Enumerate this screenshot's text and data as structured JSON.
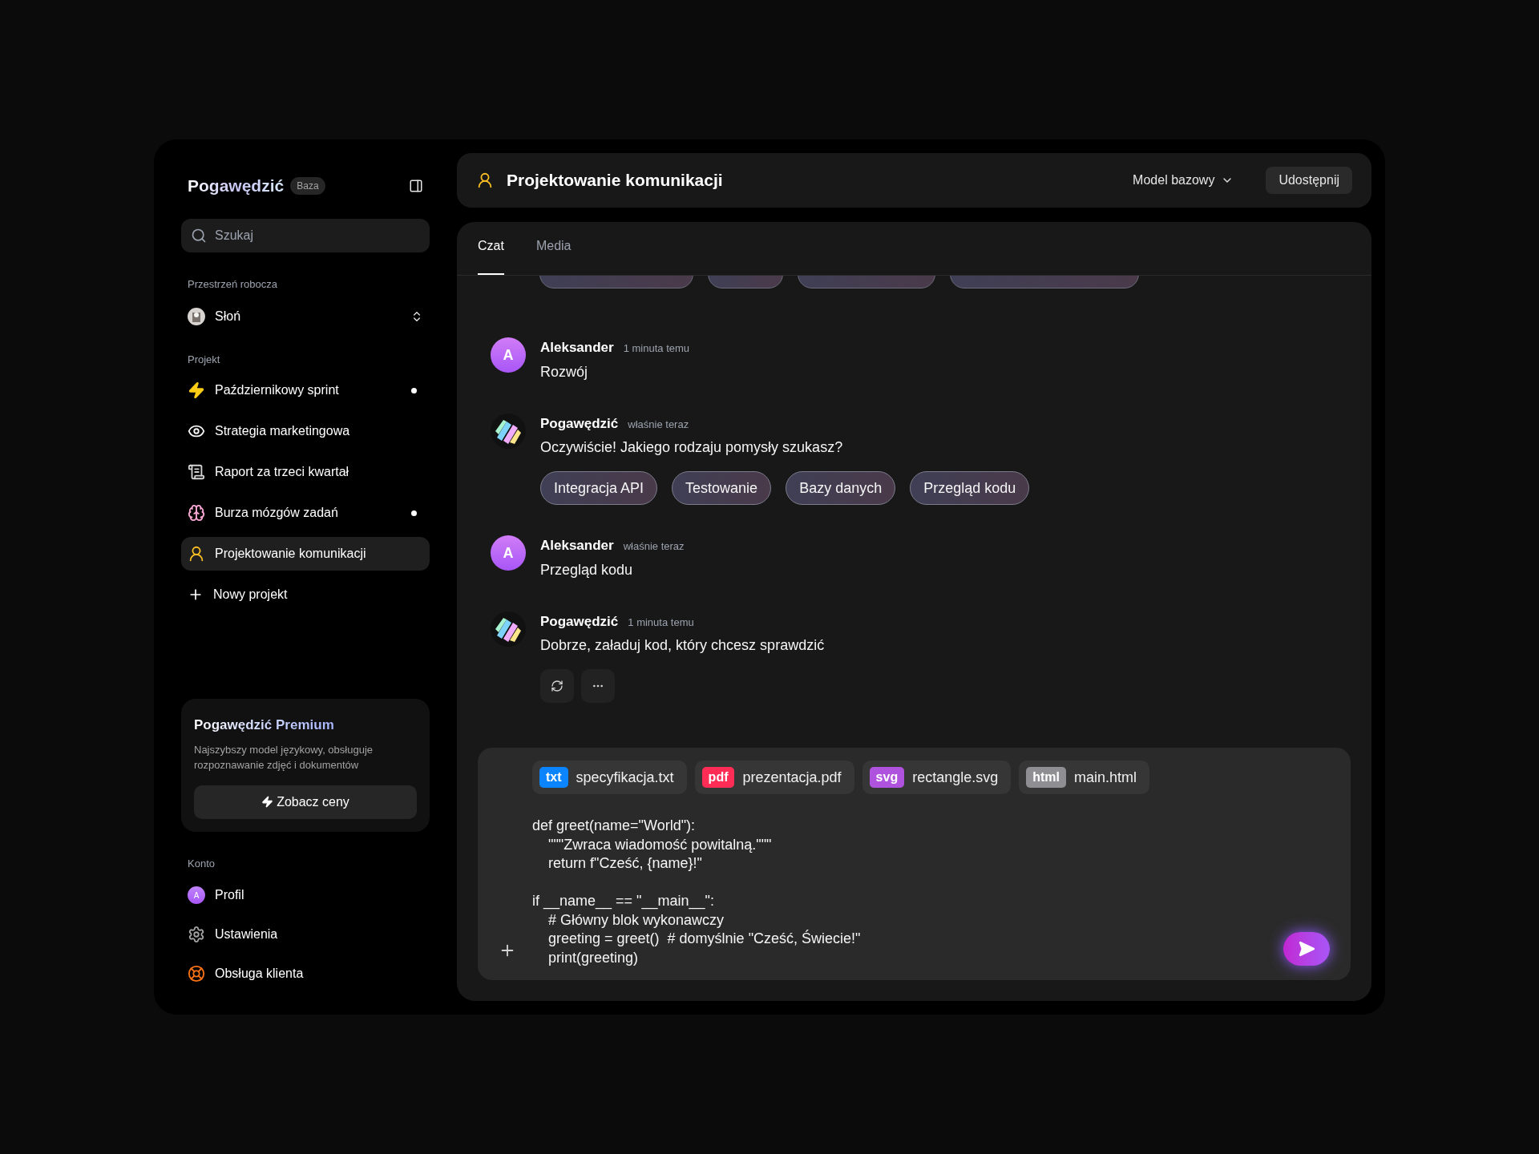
{
  "sidebar": {
    "logo": "Pogawędzić",
    "plan_badge": "Baza",
    "search": {
      "placeholder": "Szukaj"
    },
    "workspace": {
      "label": "Przestrzeń robocza",
      "name": "Słoń"
    },
    "projects_label": "Projekt",
    "projects": [
      {
        "kind": "bolt",
        "label": "Październikowy sprint",
        "unread": true,
        "selected": false
      },
      {
        "kind": "eyes",
        "label": "Strategia marketingowa",
        "unread": false,
        "selected": false
      },
      {
        "kind": "scroll",
        "label": "Raport za trzeci kwartał",
        "unread": false,
        "selected": false
      },
      {
        "kind": "brain",
        "label": "Burza mózgów zadań",
        "unread": true,
        "selected": false
      },
      {
        "kind": "person",
        "label": "Projektowanie komunikacji",
        "unread": false,
        "selected": true
      }
    ],
    "new_project": "Nowy projekt",
    "premium": {
      "title": "Pogawędzić Premium",
      "description": "Najszybszy model językowy, obsługuje rozpoznawanie zdjęć i dokumentów",
      "button": "Zobacz ceny"
    },
    "account_label": "Konto",
    "account": [
      {
        "kind": "avatar",
        "avatar_letter": "A",
        "label": "Profil"
      },
      {
        "kind": "gear",
        "label": "Ustawienia"
      },
      {
        "kind": "lifebuoy",
        "label": "Obsługa klienta"
      }
    ]
  },
  "header": {
    "title": "Projektowanie komunikacji",
    "model": "Model bazowy",
    "share": "Udostępnij"
  },
  "tabs": [
    {
      "label": "Czat",
      "selected": true
    },
    {
      "label": "Media",
      "selected": false
    }
  ],
  "messages": [
    {
      "kind": "user",
      "avatar_letter": "A",
      "author": "Aleksander",
      "time": "1 minuta temu",
      "text": "Rozwój"
    },
    {
      "kind": "bot",
      "author": "Pogawędzić",
      "time": "właśnie teraz",
      "text": "Oczywiście! Jakiego rodzaju pomysły szukasz?",
      "suggestions": [
        "Integracja API",
        "Testowanie",
        "Bazy danych",
        "Przegląd kodu"
      ]
    },
    {
      "kind": "user",
      "avatar_letter": "A",
      "author": "Aleksander",
      "time": "właśnie teraz",
      "text": "Przegląd kodu"
    },
    {
      "kind": "bot",
      "author": "Pogawędzić",
      "time": "1 minuta temu",
      "text": "Dobrze, załaduj kod, który chcesz sprawdzić",
      "actions": true
    }
  ],
  "composer": {
    "attachments": [
      {
        "type": "txt",
        "name": "specyfikacja.txt",
        "color": "#0a84ff"
      },
      {
        "type": "pdf",
        "name": "prezentacja.pdf",
        "color": "#ff2d55"
      },
      {
        "type": "svg",
        "name": "rectangle.svg",
        "color": "#af52de"
      },
      {
        "type": "html",
        "name": "main.html",
        "color": "#8e8e93"
      }
    ],
    "value": "def greet(name=\"World\"):\n    \"\"\"Zwraca wiadomość powitalną.\"\"\"\n    return f\"Cześć, {name}!\"\n\nif __name__ == \"__main__\":\n    # Główny blok wykonawczy\n    greeting = greet()  # domyślnie \"Cześć, Świecie!\"\n    print(greeting)"
  }
}
